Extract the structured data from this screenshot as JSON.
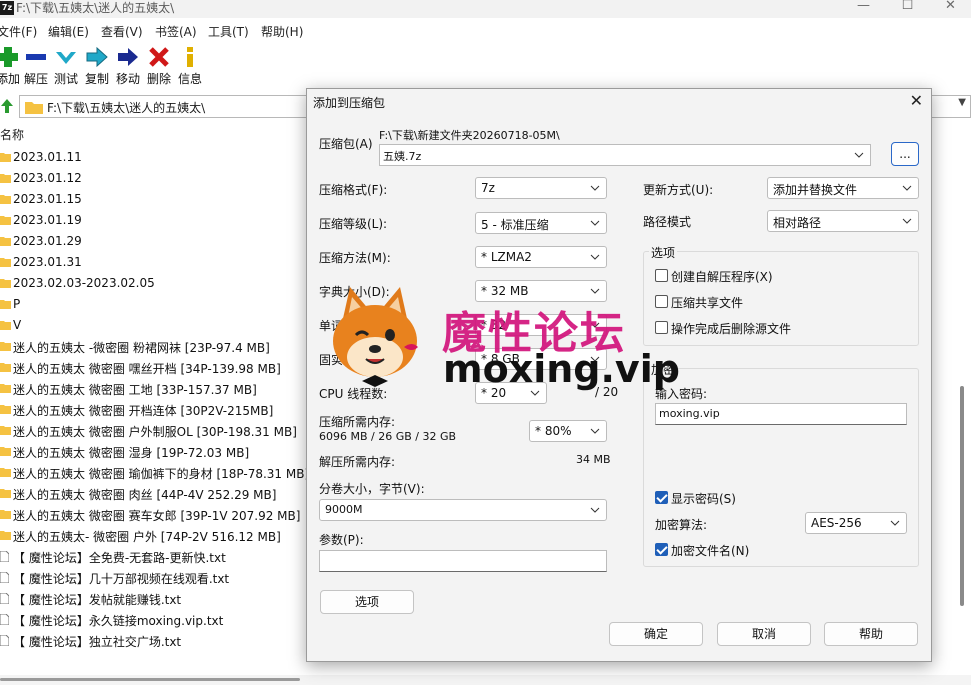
{
  "window": {
    "title": "F:\\下载\\五姨太\\迷人的五姨太\\",
    "app_badge": "7z",
    "controls": [
      "—",
      "☐",
      "✕"
    ]
  },
  "menu": [
    "文件(F)",
    "编辑(E)",
    "查看(V)",
    "书签(A)",
    "工具(T)",
    "帮助(H)"
  ],
  "toolbar": {
    "add": "添加",
    "extract": "解压",
    "test": "测试",
    "copy": "复制",
    "move": "移动",
    "delete": "删除",
    "info": "信息"
  },
  "address": {
    "path": "F:\\下载\\五姨太\\迷人的五姨太\\"
  },
  "filelist": {
    "column_name": "名称",
    "folders": [
      "2023.01.11",
      "2023.01.12",
      "2023.01.15",
      "2023.01.19",
      "2023.01.29",
      "2023.01.31",
      "2023.02.03-2023.02.05",
      "P",
      "V",
      "迷人的五姨太 -微密圈 粉裙网袜 [23P-97.4 MB]",
      "迷人的五姨太 微密圈 嘿丝开档 [34P-139.98 MB]",
      "迷人的五姨太 微密圈 工地 [33P-157.37 MB]",
      "迷人的五姨太 微密圈 开档连体 [30P2V-215MB]",
      "迷人的五姨太 微密圈 户外制服OL [30P-198.31 MB]",
      "迷人的五姨太 微密圈 湿身 [19P-72.03 MB]",
      "迷人的五姨太 微密圈 瑜伽裤下的身材 [18P-78.31 MB]",
      "迷人的五姨太 微密圈 肉丝 [44P-4V 252.29 MB]",
      "迷人的五姨太 微密圈 赛车女郎 [39P-1V 207.92 MB]",
      "迷人的五姨太- 微密圈 户外 [74P-2V 516.12 MB]"
    ],
    "files": [
      "【 魔性论坛】全免费-无套路-更新快.txt",
      "【 魔性论坛】几十万部视频在线观看.txt",
      "【 魔性论坛】发帖就能赚钱.txt",
      "【 魔性论坛】永久链接moxing.vip.txt",
      "【 魔性论坛】独立社交广场.txt"
    ]
  },
  "dialog": {
    "title": "添加到压缩包",
    "archive_label": "压缩包(A)",
    "archive_dir": "F:\\下载\\新建文件夹20260718-05M\\",
    "archive_name": "五姨.7z",
    "browse": "...",
    "format_label": "压缩格式(F):",
    "format_value": "7z",
    "level_label": "压缩等级(L):",
    "level_value": "5 - 标准压缩",
    "method_label": "压缩方法(M):",
    "method_value": "*  LZMA2",
    "dict_label": "字典大小(D):",
    "dict_value": "*  32 MB",
    "word_label": "单词大小(W):",
    "word_value": "*  32",
    "solid_label": "固实数据大小:",
    "solid_value": "*  8 GB",
    "cpu_label": "CPU 线程数:",
    "cpu_value": "*  20",
    "cpu_total": "/ 20",
    "mem_comp_label": "压缩所需内存:",
    "mem_comp_value": "6096 MB / 26 GB / 32 GB",
    "mem_pct": "*  80%",
    "mem_decomp_label": "解压所需内存:",
    "mem_decomp_value": "34 MB",
    "volume_label": "分卷大小，字节(V):",
    "volume_value": "9000M",
    "params_label": "参数(P):",
    "params_value": "",
    "options_button": "选项",
    "update_label": "更新方式(U):",
    "update_value": "添加并替换文件",
    "path_label": "路径模式",
    "path_value": "相对路径",
    "options_group": "选项",
    "opt_sfx": "创建自解压程序(X)",
    "opt_shared": "压缩共享文件",
    "opt_delete": "操作完成后删除源文件",
    "enc_group": "加密",
    "pwd_label": "输入密码:",
    "pwd_value": "moxing.vip",
    "show_pwd": "显示密码(S)",
    "enc_method_label": "加密算法:",
    "enc_method_value": "AES-256",
    "enc_names": "加密文件名(N)",
    "ok": "确定",
    "cancel": "取消",
    "help": "帮助"
  },
  "watermark": {
    "title": "魔性论坛",
    "url": "moxing.vip"
  },
  "colors": {
    "folder": "#f5c242",
    "accent": "#1f5fb8",
    "watermark": "#d2147c"
  }
}
